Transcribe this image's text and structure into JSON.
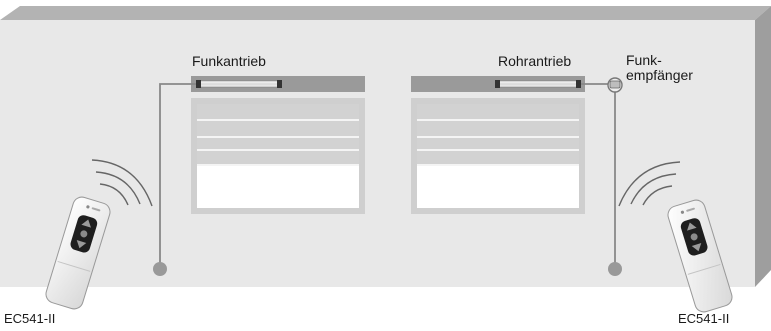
{
  "labels": {
    "left_drive": "Funkantrieb",
    "right_drive": "Rohrantrieb",
    "receiver_line1": "Funk-",
    "receiver_line2": "empfänger",
    "left_remote_model": "EC541-II",
    "right_remote_model": "EC541-II"
  },
  "colors": {
    "wall_face": "#e8e8e8",
    "wall_top": "#b3b3b3",
    "wall_side": "#9e9e9e",
    "box": "#9a9a9a",
    "shutter_slat": "#d2d2d2",
    "window_glass": "#ffffff",
    "wire": "#888888",
    "remote_body": "#f4f4f4",
    "remote_pad": "#1e1e1e"
  },
  "icons": {
    "remote": "remote-control-icon",
    "signal": "radio-waves-icon",
    "receiver": "radio-receiver-icon"
  }
}
